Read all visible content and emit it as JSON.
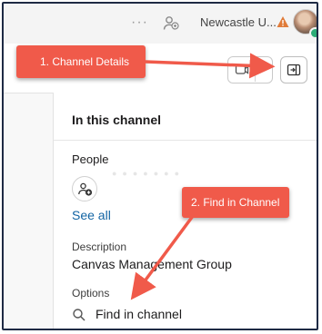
{
  "topbar": {
    "more_dots": "···",
    "workspace_name": "Newcastle U...",
    "icons": [
      "people-icon",
      "warning-icon",
      "avatar"
    ]
  },
  "header": {
    "icons": [
      "huddle-icon",
      "channel-details-icon"
    ]
  },
  "panel": {
    "title": "In this channel",
    "people_label": "People",
    "see_all": "See all",
    "description_label": "Description",
    "description_value": "Canvas Management Group",
    "options_label": "Options",
    "find_in_channel": "Find in channel"
  },
  "annotations": {
    "callout1": "1. Channel Details",
    "callout2": "2. Find in Channel"
  },
  "colors": {
    "callout": "#f05a4a",
    "link": "#1264a3",
    "warning": "#e07b39",
    "online": "#2bac76"
  }
}
